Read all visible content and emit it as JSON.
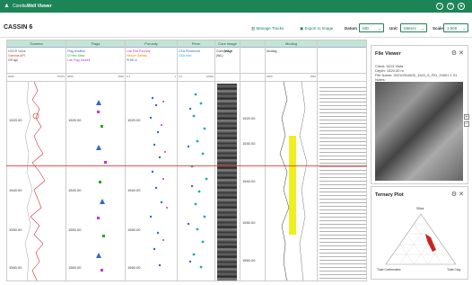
{
  "app": {
    "name": "Corelia",
    "module": "Well Viewer"
  },
  "well": {
    "name": "CASSIN 6"
  },
  "toolbar": {
    "manage_tracks": "Manage Tracks",
    "export": "Export to Image",
    "datum_label": "Datum",
    "datum_value": "MD",
    "unit_label": "Unit",
    "unit_value": "Meters",
    "scale_label": "Scale",
    "scale_value": "1:500"
  },
  "tracks": [
    {
      "title": "Gamma",
      "legend": [
        "HSGR Value",
        "Gamma API",
        "CR api"
      ],
      "scale_min": "0000",
      "scale_max": "15075"
    },
    {
      "title": "Flags",
      "legend": [
        "Flag Mudline",
        "Ct Hex Slew",
        "Lab Flag Inkwell"
      ],
      "scale_min": "0000",
      "scale_max": "1500"
    },
    {
      "title": "Porosity",
      "legend": [
        "Lab Plat Porosity",
        "Helium Salinity",
        "PHIE-A"
      ],
      "scale_min": "0.1",
      "scale_max": "1"
    },
    {
      "title": "Perm",
      "legend": [
        "CEA Preserved",
        "CEA Hori"
      ],
      "scale_min": "0.1",
      "scale_max": "10000"
    },
    {
      "title": "Core image (WL)",
      "legend": [
        "Core Image (WL)"
      ],
      "scale_min": "",
      "scale_max": ""
    },
    {
      "title": "",
      "legend": [],
      "scale_min": "",
      "scale_max": ""
    },
    {
      "title": "Mudlog",
      "legend": [
        "Mudlog"
      ],
      "scale_min": "0000",
      "scale_max": "1500"
    },
    {
      "title": "",
      "legend": [],
      "scale_min": "",
      "scale_max": ""
    }
  ],
  "depths": [
    "1520.00",
    "1530.00",
    "1540.00",
    "1550.00",
    "1560.00",
    "1570.00"
  ],
  "file_viewer": {
    "title": "File Viewer",
    "client": "Client: 5214 Vista",
    "depth": "Depth: 1520.00 m",
    "file_name": "File Name: 20210310600_1522_5_FID_20001.1 01",
    "notes": "Notes:"
  },
  "ternary": {
    "title": "Ternary Plot",
    "apex_top": "Silica",
    "apex_left": "Total Carbonates",
    "apex_right": "Total Clay"
  },
  "colors": {
    "brand": "#1d8457",
    "track_header": "#c3e5d3",
    "reference_line": "#e22222"
  }
}
